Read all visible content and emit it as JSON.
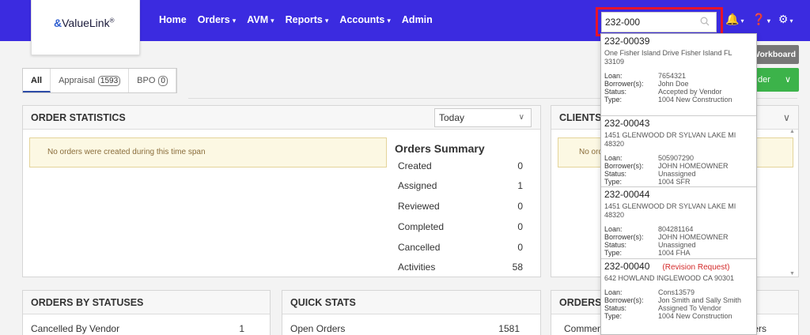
{
  "brand": {
    "logo_text": "ValueLink",
    "logo_mark": "&",
    "reg": "®"
  },
  "nav": [
    {
      "label": "Home",
      "caret": false
    },
    {
      "label": "Orders",
      "caret": true
    },
    {
      "label": "AVM",
      "caret": true
    },
    {
      "label": "Reports",
      "caret": true
    },
    {
      "label": "Accounts",
      "caret": true
    },
    {
      "label": "Admin",
      "caret": false
    }
  ],
  "search": {
    "value": "232-000",
    "placeholder": ""
  },
  "top_icons": [
    "bell-icon",
    "help-icon",
    "gear-icon"
  ],
  "buttons": {
    "workboard": "Workboard",
    "order": "der"
  },
  "tabs": [
    {
      "label": "All",
      "count": ""
    },
    {
      "label": "Appraisal",
      "count": "1593"
    },
    {
      "label": "BPO",
      "count": "0"
    }
  ],
  "order_statistics": {
    "title": "ORDER STATISTICS",
    "range": "Today",
    "alert": "No orders were created during this time span",
    "summary_title": "Orders Summary",
    "summary": [
      {
        "label": "Created",
        "value": "0"
      },
      {
        "label": "Assigned",
        "value": "1"
      },
      {
        "label": "Reviewed",
        "value": "0"
      },
      {
        "label": "Completed",
        "value": "0"
      },
      {
        "label": "Cancelled",
        "value": "0"
      },
      {
        "label": "Activities",
        "value": "58"
      }
    ]
  },
  "clients": {
    "title": "CLIENTS",
    "alert": "No orde"
  },
  "orders_by_statuses": {
    "title": "ORDERS BY STATUSES",
    "row_label": "Cancelled By Vendor",
    "row_value": "1"
  },
  "quick_stats": {
    "title": "QUICK STATS",
    "row_label": "Open Orders",
    "row_value": "1581"
  },
  "orders_panel": {
    "title": "ORDERS",
    "row_label": "Comment",
    "row_tail": "ers"
  },
  "search_results": {
    "labels": {
      "loan": "Loan:",
      "borrower": "Borrower(s):",
      "status": "Status:",
      "type": "Type:"
    },
    "items": [
      {
        "number": "232-00039",
        "flag": "",
        "address": "One Fisher Island Drive Fisher Island FL 33109",
        "loan": "7654321",
        "borrower": "John Doe",
        "status": "Accepted by Vendor",
        "type": "1004 New Construction"
      },
      {
        "number": "232-00043",
        "flag": "",
        "address": "1451 GLENWOOD DR SYLVAN LAKE MI 48320",
        "loan": "505907290",
        "borrower": "JOHN HOMEOWNER",
        "status": "Unassigned",
        "type": "1004 SFR"
      },
      {
        "number": "232-00044",
        "flag": "",
        "address": "1451 GLENWOOD DR SYLVAN LAKE MI 48320",
        "loan": "804281164",
        "borrower": "JOHN HOMEOWNER",
        "status": "Unassigned",
        "type": "1004 FHA"
      },
      {
        "number": "232-00040",
        "flag": "(Revision Request)",
        "address": "642 HOWLAND INGLEWOOD CA 90301",
        "loan": "Cons13579",
        "borrower": "Jon Smith and Sally Smith",
        "status": "Assigned To Vendor",
        "type": "1004 New Construction"
      }
    ]
  },
  "colors": {
    "topbar": "#3b2be0",
    "highlight": "#e8132a",
    "success": "#3cb34a",
    "alert_bg": "#fcf8e3"
  }
}
